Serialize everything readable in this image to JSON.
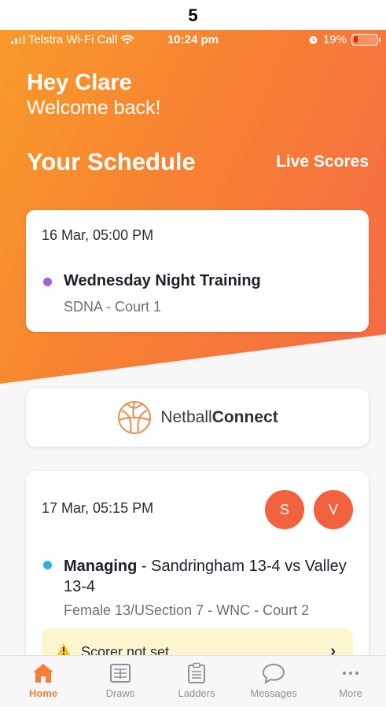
{
  "page_label": "5",
  "status_bar": {
    "carrier": "Telstra Wi-Fi Call",
    "time": "10:24 pm",
    "battery": "19%",
    "battery_level": 0.19
  },
  "header": {
    "greeting": "Hey Clare",
    "welcome": "Welcome back!",
    "title": "Your Schedule",
    "live_scores": "Live Scores"
  },
  "colors": {
    "accent": "#f57f36",
    "dot_purple": "#a45de0",
    "dot_blue": "#2ab0ee",
    "avatar": "#f2623e"
  },
  "events": [
    {
      "date": "16 Mar, 05:00 PM",
      "title": "Wednesday Night Training",
      "location": "SDNA - Court 1"
    },
    {
      "date": "17 Mar, 05:15 PM",
      "avatars": [
        "S",
        "V"
      ],
      "role": "Managing",
      "title": " - Sandringham 13-4 vs Valley 13-4",
      "location": "Female 13/USection 7 - WNC - Court 2",
      "warning": "Scorer not set"
    }
  ],
  "logo": {
    "prefix": "Netball",
    "bold": "Connect"
  },
  "tabs": [
    {
      "label": "Home",
      "icon": "home-icon"
    },
    {
      "label": "Draws",
      "icon": "draws-icon"
    },
    {
      "label": "Ladders",
      "icon": "ladders-icon"
    },
    {
      "label": "Messages",
      "icon": "messages-icon"
    },
    {
      "label": "More",
      "icon": "more-icon"
    }
  ]
}
